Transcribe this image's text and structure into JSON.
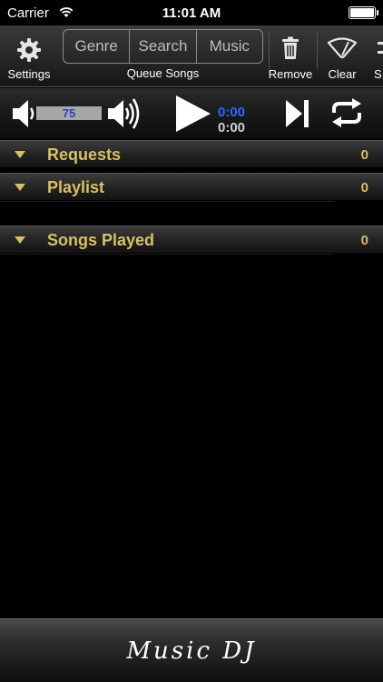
{
  "status_bar": {
    "carrier": "Carrier",
    "time": "11:01 AM"
  },
  "toolbar": {
    "settings_label": "Settings",
    "segments": [
      "Genre",
      "Search",
      "Music"
    ],
    "queue_label": "Queue Songs",
    "remove_label": "Remove",
    "clear_label": "Clear",
    "shuffle_label": "S"
  },
  "player": {
    "volume": "75",
    "time_elapsed": "0:00",
    "time_total": "0:00"
  },
  "sections": {
    "requests": {
      "title": "Requests",
      "count": "0"
    },
    "playlist": {
      "title": "Playlist",
      "count": "0"
    },
    "songs_played": {
      "title": "Songs Played",
      "count": "0"
    }
  },
  "footer": {
    "title": "Music DJ"
  },
  "colors": {
    "accent": "#d8c15f",
    "time_blue": "#2e68ff",
    "volume_blue": "#1b43c9"
  },
  "icons": [
    "wifi-icon",
    "battery-icon",
    "gear-icon",
    "trash-icon",
    "wiper-icon",
    "shuffle-icon",
    "volume-low-icon",
    "volume-high-icon",
    "play-icon",
    "next-icon",
    "repeat-icon",
    "triangle-down-icon"
  ]
}
